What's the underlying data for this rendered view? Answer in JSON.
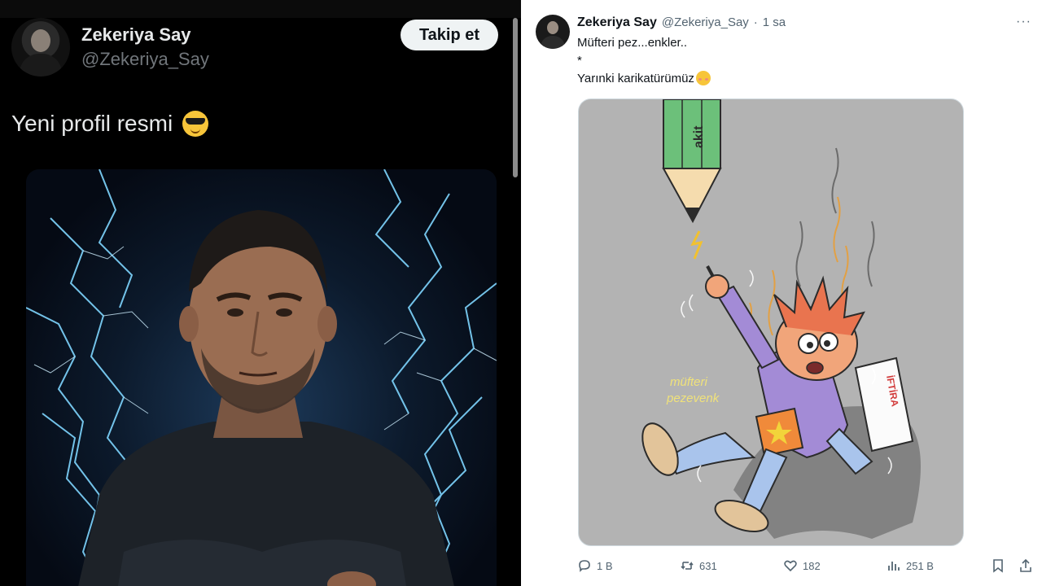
{
  "left": {
    "user": {
      "name": "Zekeriya Say",
      "handle": "@Zekeriya_Say"
    },
    "follow_label": "Takip et",
    "post_text": "Yeni profil resmi",
    "emoji": "smiling-face-with-sunglasses"
  },
  "right": {
    "user": {
      "name": "Zekeriya Say",
      "handle": "@Zekeriya_Say",
      "separator": "·",
      "time": "1 sa"
    },
    "more_label": "···",
    "lines": [
      "Müfteri pez...enkler..",
      "*",
      "Yarınki karikatürümüz"
    ],
    "emoji": "smiling-face",
    "cartoon": {
      "pencil_text": "akit",
      "label_text_1": "müfteri",
      "label_text_2": "pezevenk",
      "paper_text": "İFTİRA"
    },
    "actions": {
      "replies": "1 B",
      "reposts": "631",
      "likes": "182",
      "views": "251 B"
    }
  },
  "colors": {
    "dark_bg": "#000000",
    "light_bg": "#ffffff",
    "follow_bg": "#eff3f4",
    "muted": "#536471",
    "lightning": "#4fc3ff"
  }
}
